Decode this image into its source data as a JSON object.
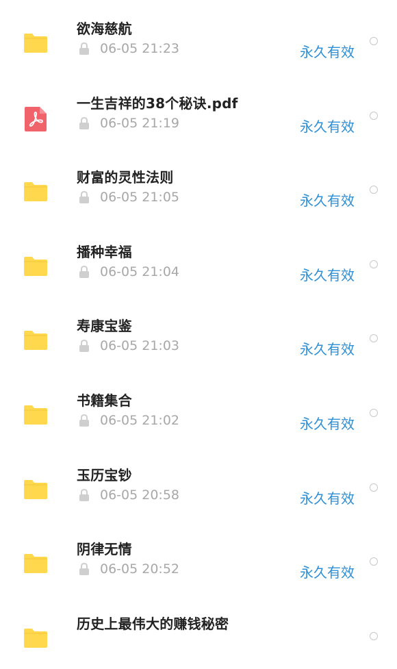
{
  "files": [
    {
      "name": "欲海慈航",
      "type": "folder",
      "icon": "folder-icon",
      "time": "06-05 21:23",
      "validity": "永久有效"
    },
    {
      "name": "一生吉祥的38个秘诀.pdf",
      "type": "pdf",
      "icon": "pdf-icon",
      "time": "06-05 21:19",
      "validity": "永久有效"
    },
    {
      "name": "财富的灵性法则",
      "type": "folder",
      "icon": "folder-icon",
      "time": "06-05 21:05",
      "validity": "永久有效"
    },
    {
      "name": "播种幸福",
      "type": "folder",
      "icon": "folder-icon",
      "time": "06-05 21:04",
      "validity": "永久有效"
    },
    {
      "name": "寿康宝鉴",
      "type": "folder",
      "icon": "folder-icon",
      "time": "06-05 21:03",
      "validity": "永久有效"
    },
    {
      "name": "书籍集合",
      "type": "folder",
      "icon": "folder-icon",
      "time": "06-05 21:02",
      "validity": "永久有效"
    },
    {
      "name": "玉历宝钞",
      "type": "folder",
      "icon": "folder-icon",
      "time": "06-05 20:58",
      "validity": "永久有效"
    },
    {
      "name": "阴律无情",
      "type": "folder",
      "icon": "folder-icon",
      "time": "06-05 20:52",
      "validity": "永久有效"
    },
    {
      "name": "历史上最伟大的赚钱秘密",
      "type": "folder",
      "icon": "folder-icon",
      "time": "",
      "validity": ""
    }
  ],
  "colors": {
    "folder": "#ffd84d",
    "pdf": "#f0636a",
    "validity": "#2d8fd6",
    "meta": "#a8a8a8",
    "title": "#222222"
  }
}
